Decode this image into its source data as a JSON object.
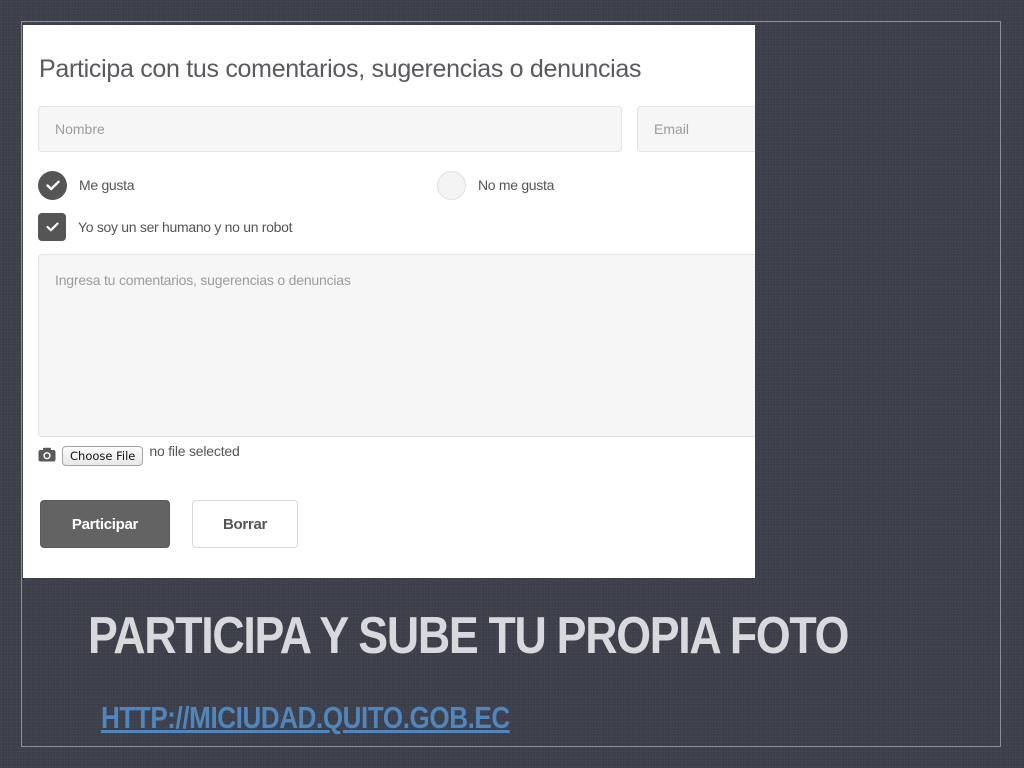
{
  "form": {
    "title": "Participa con tus comentarios, sugerencias o denuncias",
    "name_placeholder": "Nombre",
    "email_placeholder": "Email",
    "option_like": "Me gusta",
    "option_dislike": "No me gusta",
    "selected_option": "Me gusta",
    "captcha_label": "Yo soy un ser humano y no un robot",
    "captcha_checked": true,
    "comment_placeholder": "Ingresa tu comentarios, sugerencias o denuncias",
    "file_button": "Choose File",
    "file_status": "no file selected",
    "submit_label": "Participar",
    "clear_label": "Borrar"
  },
  "slide": {
    "title": "PARTICIPA Y SUBE TU PROPIA FOTO",
    "link": "HTTP://MICIUDAD.QUITO.GOB.EC"
  },
  "icons": {
    "check": "check-icon",
    "camera": "camera-icon"
  },
  "colors": {
    "background": "#3d3f4b",
    "panel": "#ffffff",
    "primary_button": "#636363",
    "title_text": "#d8d9dc",
    "link": "#4e86bd"
  }
}
